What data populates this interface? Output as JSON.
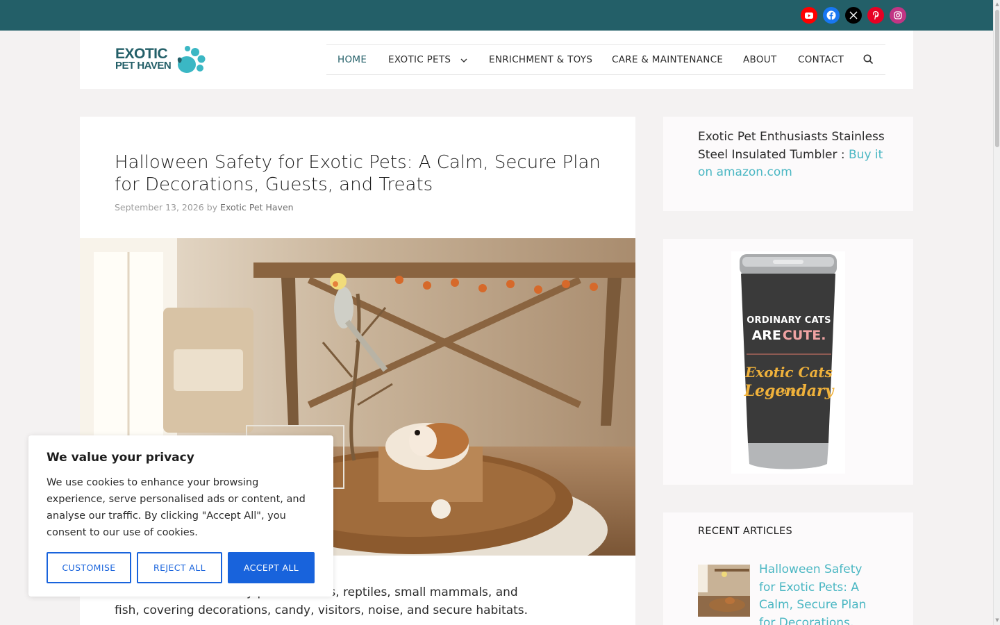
{
  "social": [
    {
      "name": "youtube-icon",
      "color": "#ff0000"
    },
    {
      "name": "facebook-icon",
      "color": "#1877f2"
    },
    {
      "name": "x-icon",
      "color": "#000000"
    },
    {
      "name": "pinterest-icon",
      "color": "#e60023"
    },
    {
      "name": "instagram-icon",
      "color": "#c13584"
    }
  ],
  "logo": {
    "line1": "EXOTIC",
    "line2": "PET HAVEN"
  },
  "nav": {
    "items": [
      "HOME",
      "EXOTIC PETS",
      "ENRICHMENT & TOYS",
      "CARE & MAINTENANCE",
      "ABOUT",
      "CONTACT"
    ],
    "active": "HOME",
    "dropdown_caret": "⌄"
  },
  "article": {
    "title": "Halloween Safety for Exotic Pets: A Calm, Secure Plan for Decorations, Guests, and Treats",
    "date": "September 13, 2026",
    "by": "by",
    "author": "Exotic Pet Haven",
    "intro_visible": "y plan for birds, reptiles, small mammals, and fish, covering decorations, candy, visitors, noise, and secure habitats.",
    "intro_line1": "y plan for birds, reptiles, small mammals, and",
    "intro_line2": "fish, covering decorations, candy, visitors, noise, and secure habitats."
  },
  "sidebar": {
    "promo_text": "Exotic Pet Enthusiasts Stainless Steel Insulated Tumbler : ",
    "promo_link": "Buy it on amazon.com",
    "tumbler": {
      "line1": "ORDINARY CATS",
      "line2a": "ARE",
      "line2b": "CUTE.",
      "line3": "Exotic Cats",
      "line3b": "are",
      "line4": "Legendary"
    },
    "recent_heading": "RECENT ARTICLES",
    "recent_title": "Halloween Safety for Exotic Pets: A Calm, Secure Plan for Decorations, Guests, and Treats"
  },
  "cookie": {
    "heading": "We value your privacy",
    "body": "We use cookies to enhance your browsing experience, serve personalised ads or content, and analyse our traffic. By clicking \"Accept All\", you consent to our use of cookies.",
    "customise": "CUSTOMISE",
    "reject": "REJECT ALL",
    "accept": "ACCEPT ALL"
  },
  "colors": {
    "brand": "#235f68",
    "link": "#4bb7c3",
    "accent": "#1863dc"
  }
}
